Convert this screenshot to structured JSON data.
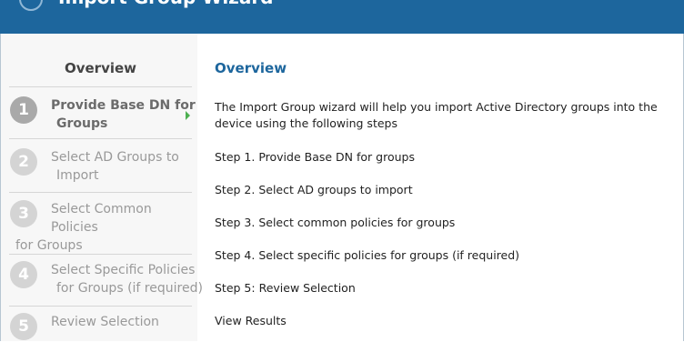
{
  "header": {
    "title": "Import Group Wizard"
  },
  "sidebar": {
    "title": "Overview",
    "steps": [
      {
        "number": "1",
        "label_line1": "Provide Base DN for",
        "label_line2": "Groups",
        "label_line3": ""
      },
      {
        "number": "2",
        "label_line1": "Select AD Groups to",
        "label_line2": "Import",
        "label_line3": ""
      },
      {
        "number": "3",
        "label_line1": "Select Common",
        "label_line2": "Policies",
        "label_line3": "for Groups"
      },
      {
        "number": "4",
        "label_line1": "Select Specific Policies",
        "label_line2": "for Groups (if required)",
        "label_line3": ""
      },
      {
        "number": "5",
        "label_line1": "Review Selection",
        "label_line2": "",
        "label_line3": ""
      }
    ]
  },
  "main": {
    "title": "Overview",
    "intro": "The Import Group wizard will help you import Active Directory groups into the device using the following steps",
    "lines": [
      "Step 1. Provide Base DN for groups",
      "Step 2. Select AD groups to import",
      "Step 3. Select common policies for groups",
      "Step 4. Select specific policies for groups (if required)",
      "Step 5: Review Selection",
      "View Results"
    ]
  },
  "colors": {
    "header_bg": "#1d669d",
    "title_blue": "#1d669d",
    "active_arrow": "#4caf50"
  }
}
